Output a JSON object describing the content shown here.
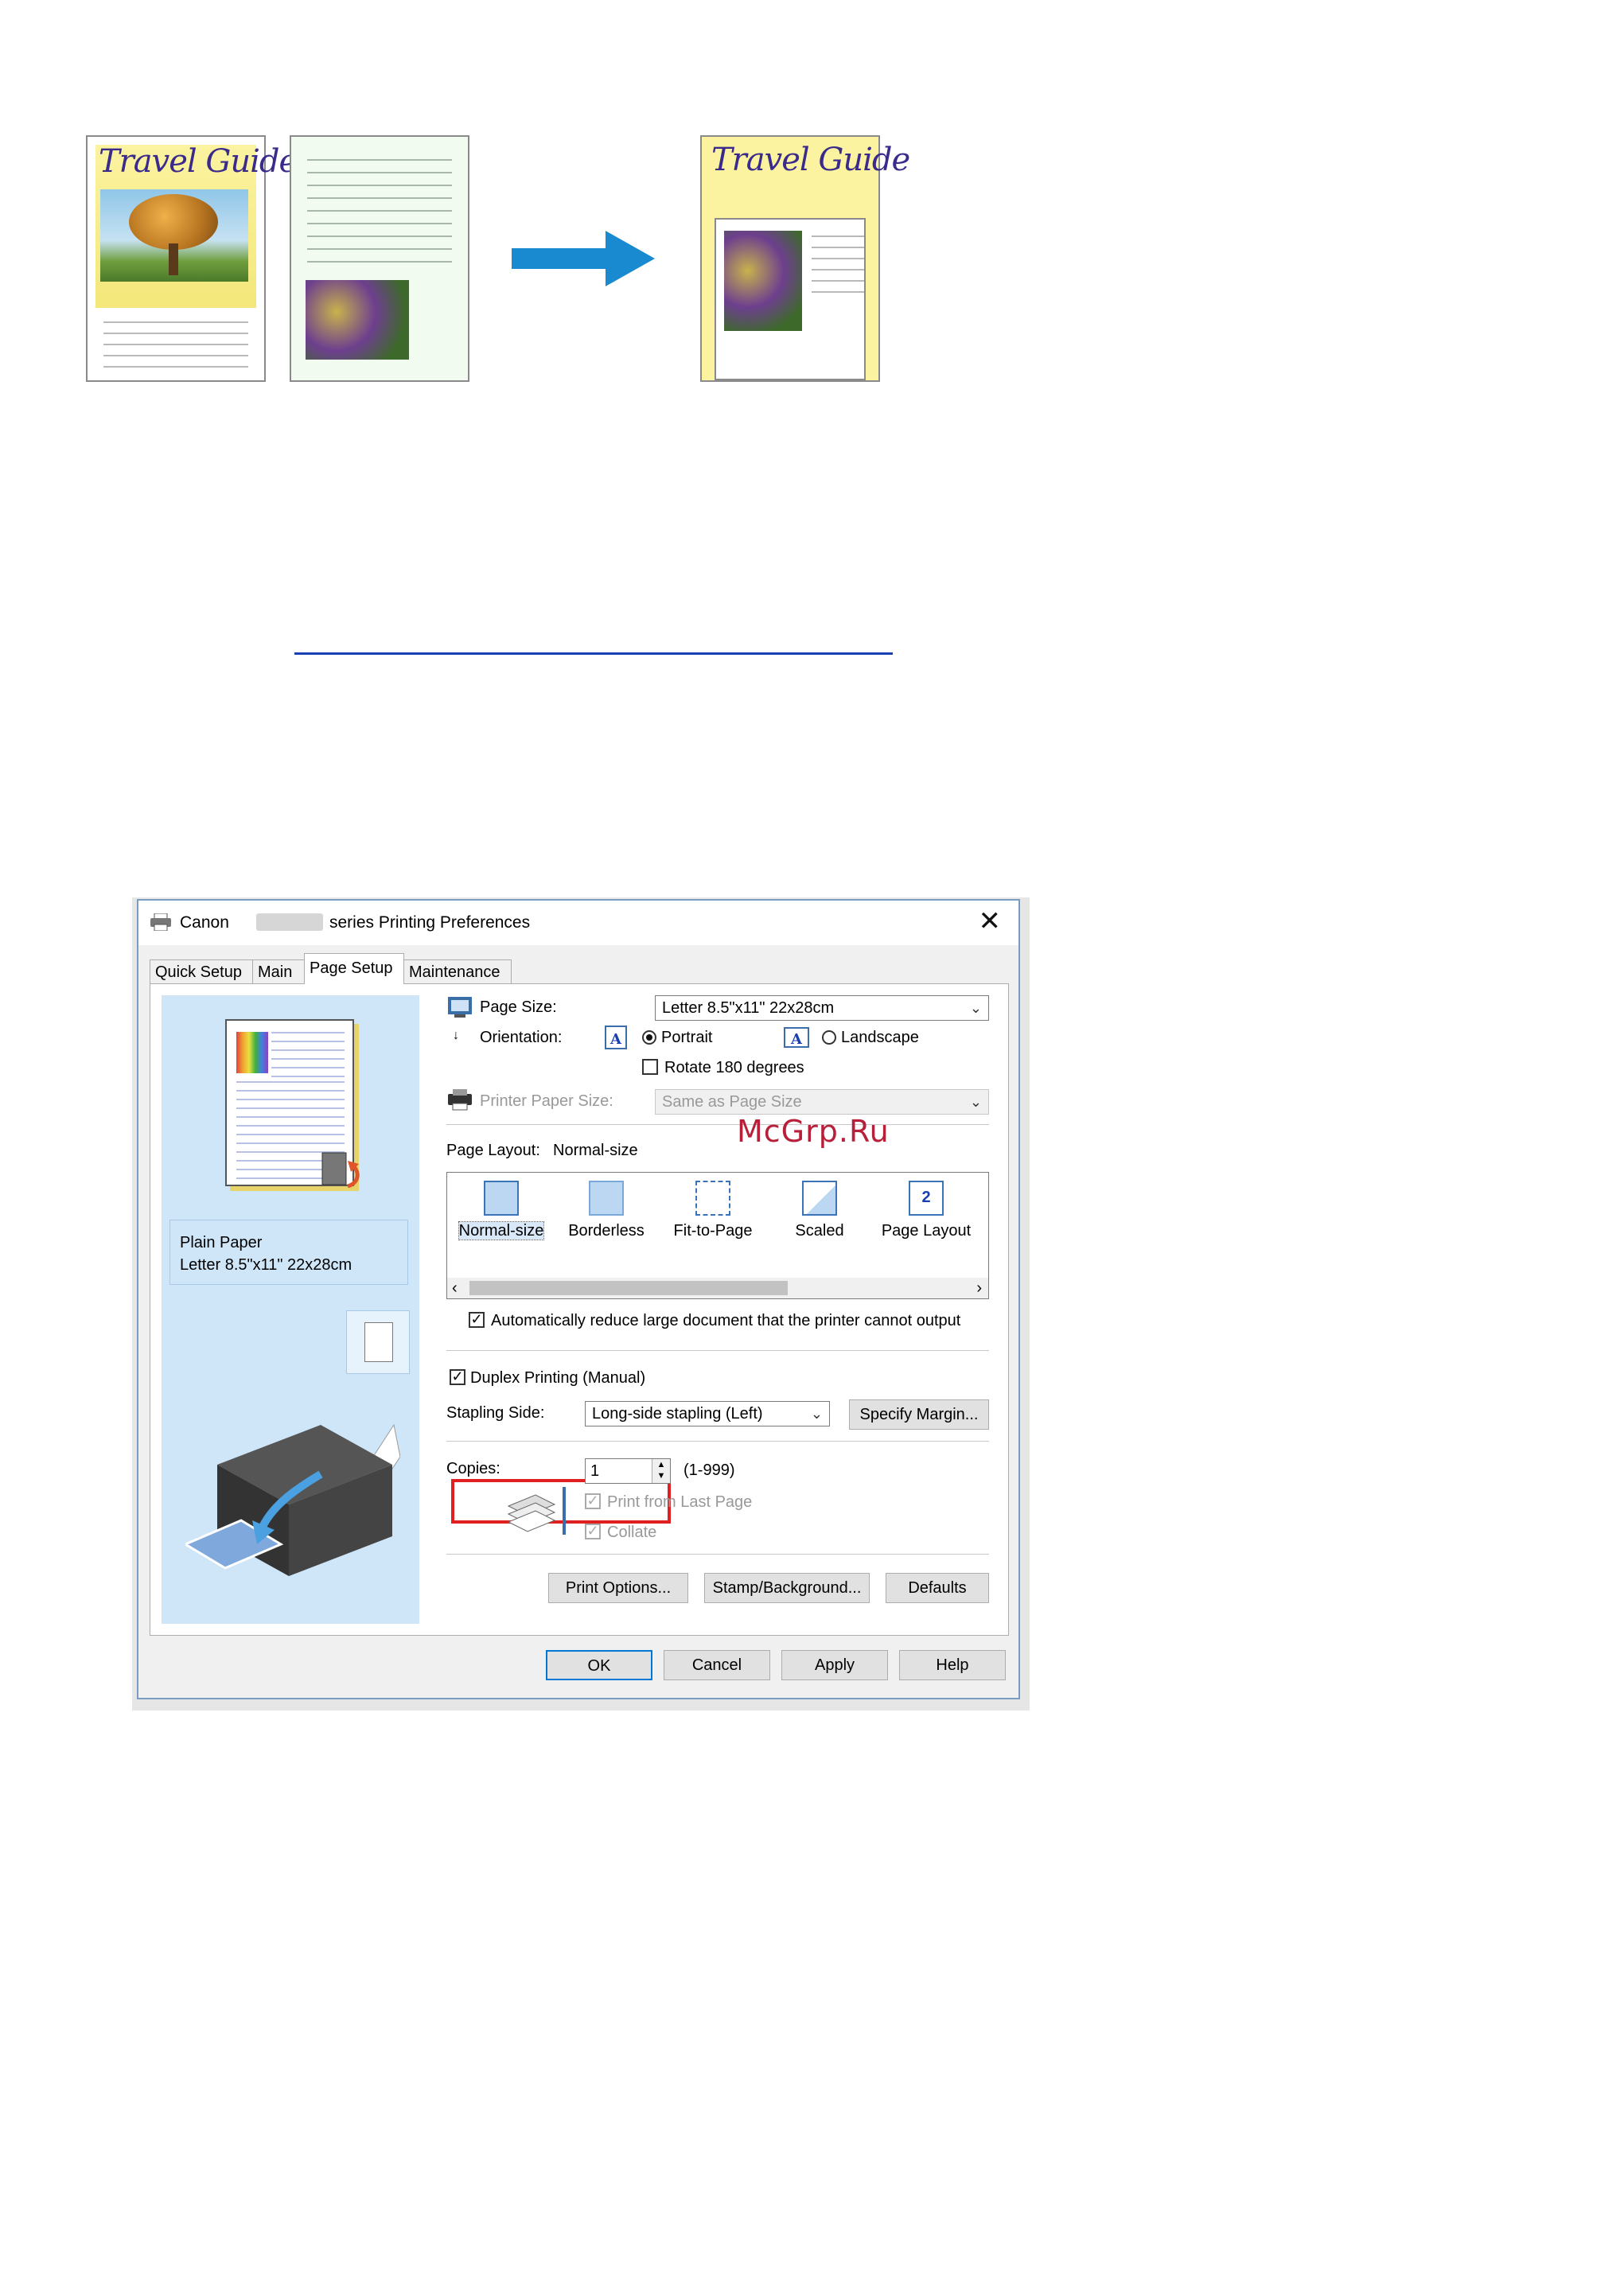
{
  "illustration": {
    "page1_title": "Travel Guide",
    "page3_title": "Travel Guide"
  },
  "dialog": {
    "title_prefix": "Canon",
    "title_suffix": "series Printing Preferences",
    "close_glyph": "✕",
    "tabs": [
      {
        "label": "Quick Setup"
      },
      {
        "label": "Main"
      },
      {
        "label": "Page Setup"
      },
      {
        "label": "Maintenance"
      }
    ],
    "active_tab": "Page Setup",
    "preview": {
      "media_type": "Plain Paper",
      "paper_size": "Letter 8.5\"x11\" 22x28cm"
    },
    "page_size": {
      "label": "Page Size:",
      "value": "Letter 8.5\"x11\" 22x28cm"
    },
    "orientation": {
      "label": "Orientation:",
      "portrait": "Portrait",
      "landscape": "Landscape",
      "rotate": "Rotate 180 degrees",
      "selected": "Portrait"
    },
    "printer_paper_size": {
      "label": "Printer Paper Size:",
      "value": "Same as Page Size"
    },
    "page_layout": {
      "label": "Page Layout:",
      "value": "Normal-size",
      "items": [
        {
          "label": "Normal-size"
        },
        {
          "label": "Borderless"
        },
        {
          "label": "Fit-to-Page"
        },
        {
          "label": "Scaled"
        },
        {
          "label": "Page Layout"
        }
      ],
      "page_layout_icon_number": "2"
    },
    "auto_reduce": "Automatically reduce large document that the printer cannot output",
    "duplex": "Duplex Printing (Manual)",
    "stapling": {
      "label": "Stapling Side:",
      "value": "Long-side stapling (Left)",
      "margin_button": "Specify Margin..."
    },
    "copies": {
      "label": "Copies:",
      "value": "1",
      "range": "(1-999)",
      "print_from_last": "Print from Last Page",
      "collate": "Collate"
    },
    "buttons": {
      "print_options": "Print Options...",
      "stamp_background": "Stamp/Background...",
      "defaults": "Defaults",
      "ok": "OK",
      "cancel": "Cancel",
      "apply": "Apply",
      "help": "Help"
    }
  },
  "watermark": "McGrp.Ru",
  "colors": {
    "highlight_box": "#e02020",
    "arrow": "#1a8ad0",
    "link_underline": "#1a3fb0"
  }
}
